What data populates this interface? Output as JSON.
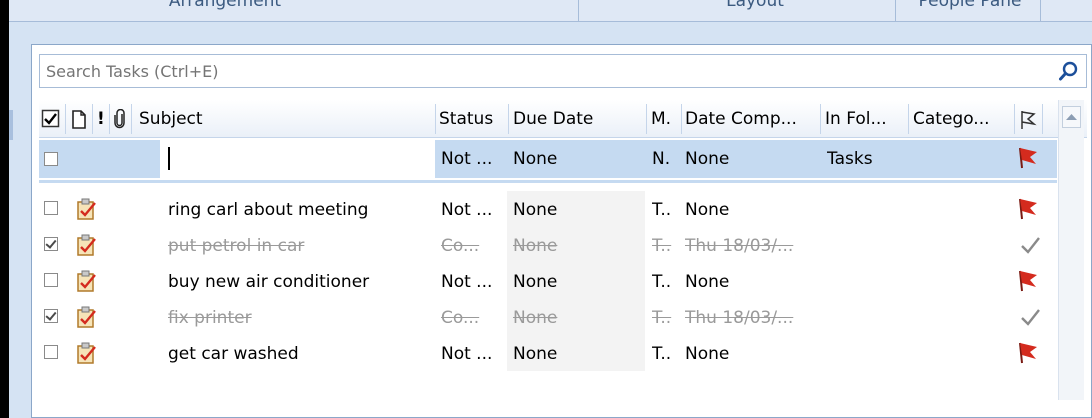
{
  "ribbon": {
    "groups": [
      "Arrangement",
      "Layout",
      "People Pane"
    ]
  },
  "search": {
    "placeholder": "Search Tasks (Ctrl+E)",
    "value": ""
  },
  "columns": {
    "subject": "Subject",
    "status": "Status",
    "due_date": "Due Date",
    "m": "M.",
    "date_completed": "Date Comp...",
    "in_folder": "In Fol...",
    "categories": "Catego..."
  },
  "new_item": {
    "subject": "",
    "status": "Not ...",
    "due_date": "None",
    "m": "N.",
    "date_completed": "None",
    "in_folder": "Tasks",
    "flag": "red-flag"
  },
  "tasks": [
    {
      "subject": "ring carl about meeting",
      "status": "Not ...",
      "due_date": "None",
      "m": "T..",
      "date_completed": "None",
      "completed": false,
      "flag": "red-flag"
    },
    {
      "subject": "put petrol in car",
      "status": "Co...",
      "due_date": "None",
      "m": "T..",
      "date_completed": "Thu 18/03/...",
      "completed": true,
      "flag": "checkmark"
    },
    {
      "subject": "buy new air conditioner",
      "status": "Not ...",
      "due_date": "None",
      "m": "T..",
      "date_completed": "None",
      "completed": false,
      "flag": "red-flag"
    },
    {
      "subject": "fix printer",
      "status": "Co...",
      "due_date": "None",
      "m": "T..",
      "date_completed": "Thu 18/03/...",
      "completed": true,
      "flag": "checkmark"
    },
    {
      "subject": "get car washed",
      "status": "Not ...",
      "due_date": "None",
      "m": "T..",
      "date_completed": "None",
      "completed": false,
      "flag": "red-flag"
    }
  ],
  "colors": {
    "selected_row": "#c5daf1",
    "flag_red": "#d42b1e",
    "completed_text": "#9a9a9a",
    "header_border": "#c5d5ea"
  }
}
